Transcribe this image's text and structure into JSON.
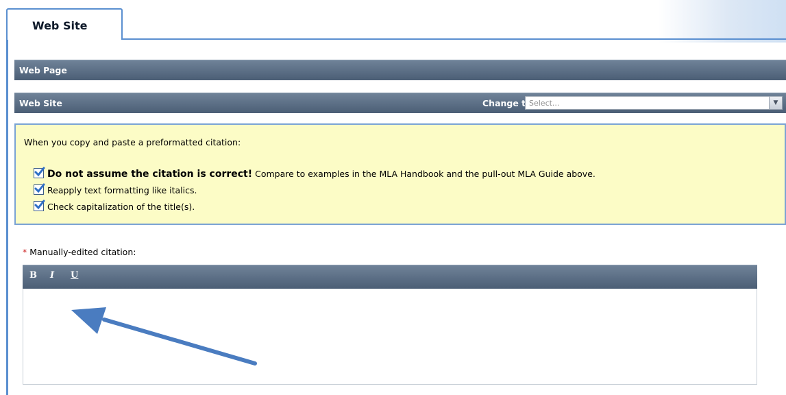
{
  "tab": {
    "label": "Web Site"
  },
  "sections": {
    "web_page": "Web Page",
    "web_site": "Web Site"
  },
  "change_to": {
    "label": "Change to:",
    "select_value": "Select..."
  },
  "notice": {
    "intro": "When you copy and paste a preformatted citation:",
    "items": [
      {
        "bold": "Do not assume the citation is correct!",
        "text": " Compare to examples in the MLA Handbook and the pull-out MLA Guide above."
      },
      {
        "bold": "",
        "text": "Reapply text formatting like italics."
      },
      {
        "bold": "",
        "text": "Check capitalization of the title(s)."
      }
    ]
  },
  "citation_field": {
    "required_mark": "*",
    "label": " Manually-edited citation:",
    "value": "",
    "toolbar": {
      "bold": "B",
      "italic": "I",
      "underline": "U"
    }
  },
  "colors": {
    "header_bar": "#4b5e75",
    "notice_bg": "#fcfcc6",
    "accent_border": "#5a8fd0",
    "annotation_arrow": "#4a7cc0"
  },
  "icons": {
    "checkbox": "checked-checkbox-icon",
    "dropdown": "chevron-down-icon",
    "annotation": "arrow-annotation"
  }
}
